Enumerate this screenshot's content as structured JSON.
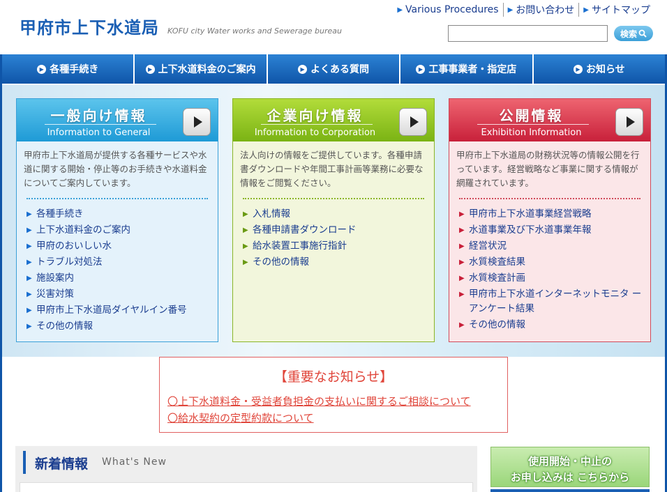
{
  "header": {
    "site_title": "甲府市上下水道局",
    "site_title_en": "KOFU city Water works and Sewerage bureau",
    "top_links": [
      "Various Procedures",
      "お問い合わせ",
      "サイトマップ"
    ],
    "search": {
      "placeholder": "",
      "button_label": "検索"
    }
  },
  "nav": {
    "items": [
      "各種手続き",
      "上下水道料金のご案内",
      "よくある質問",
      "工事事業者・指定店",
      "お知らせ"
    ]
  },
  "panels": [
    {
      "title": "一般向け情報",
      "subtitle": "Information to General",
      "description": "甲府市上下水道局が提供する各種サービスや水道に関する開始・停止等のお手続きや水道料金についてご案内しています。",
      "links": [
        "各種手続き",
        "上下水道料金のご案内",
        "甲府のおいしい水",
        "トラブル対処法",
        "施設案内",
        "災害対策",
        "甲府市上下水道局ダイヤルイン番号",
        "その他の情報"
      ],
      "colors": {
        "head": "#2aa8dc",
        "border": "#3aa0d8",
        "body": "#e4f2fb",
        "accent": "#1a6fd0"
      }
    },
    {
      "title": "企業向け情報",
      "subtitle": "Information to Corporation",
      "description": "法人向けの情報をご提供しています。各種申請書ダウンロードや年間工事計画等業務に必要な情報をご閲覧ください。",
      "links": [
        "入札情報",
        "各種申請書ダウンロード",
        "給水装置工事施行指針",
        "その他の情報"
      ],
      "colors": {
        "head": "#8cc31c",
        "border": "#8ab526",
        "body": "#f2f6dc",
        "accent": "#6a9a14"
      }
    },
    {
      "title": "公開情報",
      "subtitle": "Exhibition Information",
      "description": "甲府市上下水道局の財務状況等の情報公開を行っています。経営戦略など事業に関する情報が網羅されています。",
      "links": [
        "甲府市上下水道事業経営戦略",
        "水道事業及び下水道事業年報",
        "経営状況",
        "水質検査結果",
        "水質検査計画",
        "甲府市上下水道インターネットモニタ ーアンケート結果",
        "その他の情報"
      ],
      "colors": {
        "head": "#d8384c",
        "border": "#d04a5a",
        "body": "#fbe6e8",
        "accent": "#c8203a"
      }
    }
  ],
  "notice": {
    "title": "【重要なお知らせ】",
    "links": [
      "〇上下水道料金・受益者負担金の支払いに関するご相談について",
      "〇給水契約の定型約款について"
    ]
  },
  "news": {
    "title": "新着情報",
    "subtitle": "What's New"
  },
  "banner": {
    "line1": "使用開始・中止の",
    "line2": "お申し込みは こちらから"
  },
  "icons": {
    "link_arrow": "chevron-right-icon",
    "search": "magnifier-icon",
    "nav_bullet": "circle-arrow-icon"
  },
  "colors": {
    "brand_blue": "#1a5fb4",
    "notice_red": "#e0453a"
  }
}
